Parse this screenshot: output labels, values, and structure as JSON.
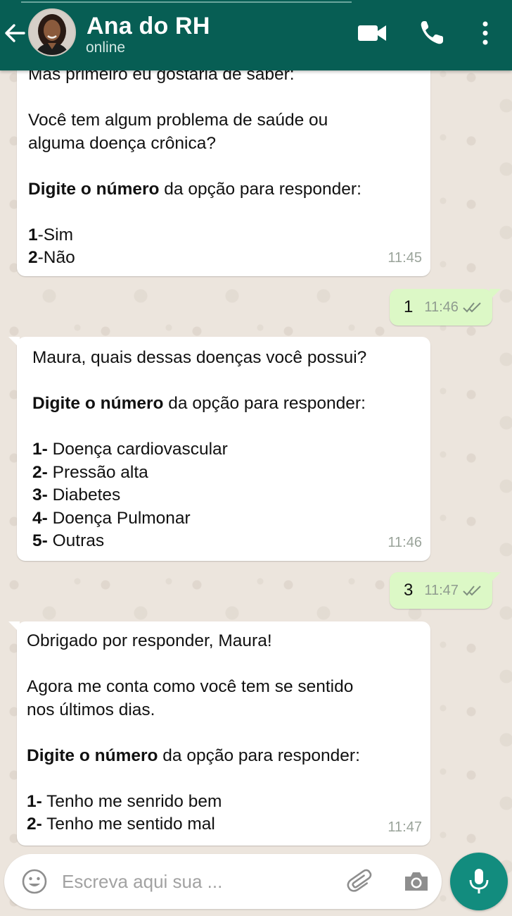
{
  "header": {
    "contact_name": "Ana do RH",
    "status": "online"
  },
  "colors": {
    "header": "#075e54",
    "incoming_bubble": "#ffffff",
    "outgoing_bubble": "#dcf8c6",
    "chat_background": "#ece5dd",
    "mic_button": "#128c7e",
    "read_ticks": "#7e8e7e"
  },
  "icons": {
    "back": "arrow-left-icon",
    "video": "video-camera-icon",
    "call": "phone-icon",
    "menu": "more-vertical-icon",
    "emoji": "emoji-icon",
    "attach": "paperclip-icon",
    "camera": "camera-icon",
    "mic": "microphone-icon",
    "read": "double-check-icon"
  },
  "messages": [
    {
      "direction": "in",
      "time": "11:45",
      "lines": [
        {
          "parts": [
            {
              "text": "Mas primeiro eu gostaria de saber:"
            }
          ]
        },
        {
          "parts": []
        },
        {
          "parts": [
            {
              "text": "Você tem algum problema de saúde ou"
            }
          ]
        },
        {
          "parts": [
            {
              "text": "alguma doença crônica?"
            }
          ]
        },
        {
          "parts": []
        },
        {
          "parts": [
            {
              "text": "Digite o número",
              "bold": true
            },
            {
              "text": " da opção para responder:"
            }
          ]
        },
        {
          "parts": []
        },
        {
          "parts": [
            {
              "text": "1",
              "bold": true
            },
            {
              "text": "-Sim"
            }
          ]
        },
        {
          "parts": [
            {
              "text": "2",
              "bold": true
            },
            {
              "text": "-Não"
            }
          ]
        }
      ]
    },
    {
      "direction": "out",
      "text": "1",
      "time": "11:46",
      "status": "read"
    },
    {
      "direction": "in",
      "time": "11:46",
      "lines": [
        {
          "parts": [
            {
              "text": "Maura, quais dessas doenças você possui?"
            }
          ]
        },
        {
          "parts": []
        },
        {
          "parts": [
            {
              "text": "Digite o número",
              "bold": true
            },
            {
              "text": " da opção para responder:"
            }
          ]
        },
        {
          "parts": []
        },
        {
          "parts": [
            {
              "text": "1-",
              "bold": true
            },
            {
              "text": " Doença cardiovascular"
            }
          ]
        },
        {
          "parts": [
            {
              "text": "2-",
              "bold": true
            },
            {
              "text": " Pressão alta"
            }
          ]
        },
        {
          "parts": [
            {
              "text": "3-",
              "bold": true
            },
            {
              "text": " Diabetes"
            }
          ]
        },
        {
          "parts": [
            {
              "text": "4-",
              "bold": true
            },
            {
              "text": " Doença Pulmonar"
            }
          ]
        },
        {
          "parts": [
            {
              "text": "5-",
              "bold": true
            },
            {
              "text": " Outras"
            }
          ]
        }
      ]
    },
    {
      "direction": "out",
      "text": "3",
      "time": "11:47",
      "status": "read"
    },
    {
      "direction": "in",
      "time": "11:47",
      "lines": [
        {
          "parts": [
            {
              "text": "Obrigado por responder, Maura!"
            }
          ]
        },
        {
          "parts": []
        },
        {
          "parts": [
            {
              "text": "Agora me conta como você tem se sentido"
            }
          ]
        },
        {
          "parts": [
            {
              "text": "nos últimos dias."
            }
          ]
        },
        {
          "parts": []
        },
        {
          "parts": [
            {
              "text": "Digite o número",
              "bold": true
            },
            {
              "text": " da opção para responder:"
            }
          ]
        },
        {
          "parts": []
        },
        {
          "parts": [
            {
              "text": "1-",
              "bold": true
            },
            {
              "text": " Tenho me senrido bem"
            }
          ]
        },
        {
          "parts": [
            {
              "text": "2-",
              "bold": true
            },
            {
              "text": " Tenho me sentido mal"
            }
          ]
        }
      ]
    }
  ],
  "input": {
    "placeholder": "Escreva aqui sua ..."
  }
}
